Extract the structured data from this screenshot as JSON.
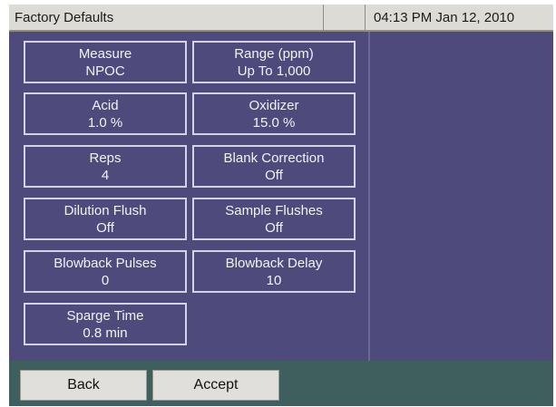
{
  "titlebar": {
    "title": "Factory Defaults",
    "clock": "04:13 PM Jan 12, 2010"
  },
  "settings": [
    {
      "label": "Measure",
      "value": "NPOC"
    },
    {
      "label": "Range (ppm)",
      "value": "Up To 1,000"
    },
    {
      "label": "Acid",
      "value": "1.0 %"
    },
    {
      "label": "Oxidizer",
      "value": "15.0 %"
    },
    {
      "label": "Reps",
      "value": "4"
    },
    {
      "label": "Blank Correction",
      "value": "Off"
    },
    {
      "label": "Dilution Flush",
      "value": "Off"
    },
    {
      "label": "Sample Flushes",
      "value": "Off"
    },
    {
      "label": "Blowback Pulses",
      "value": "0"
    },
    {
      "label": "Blowback Delay",
      "value": "10"
    },
    {
      "label": "Sparge Time",
      "value": "0.8 min"
    }
  ],
  "buttons": {
    "back": "Back",
    "accept": "Accept"
  },
  "colors": {
    "panel": "#4e4a7c",
    "titlebar": "#dcdbd6",
    "bottombar": "#3f5f5f",
    "tile_border": "#d4d2e4"
  }
}
